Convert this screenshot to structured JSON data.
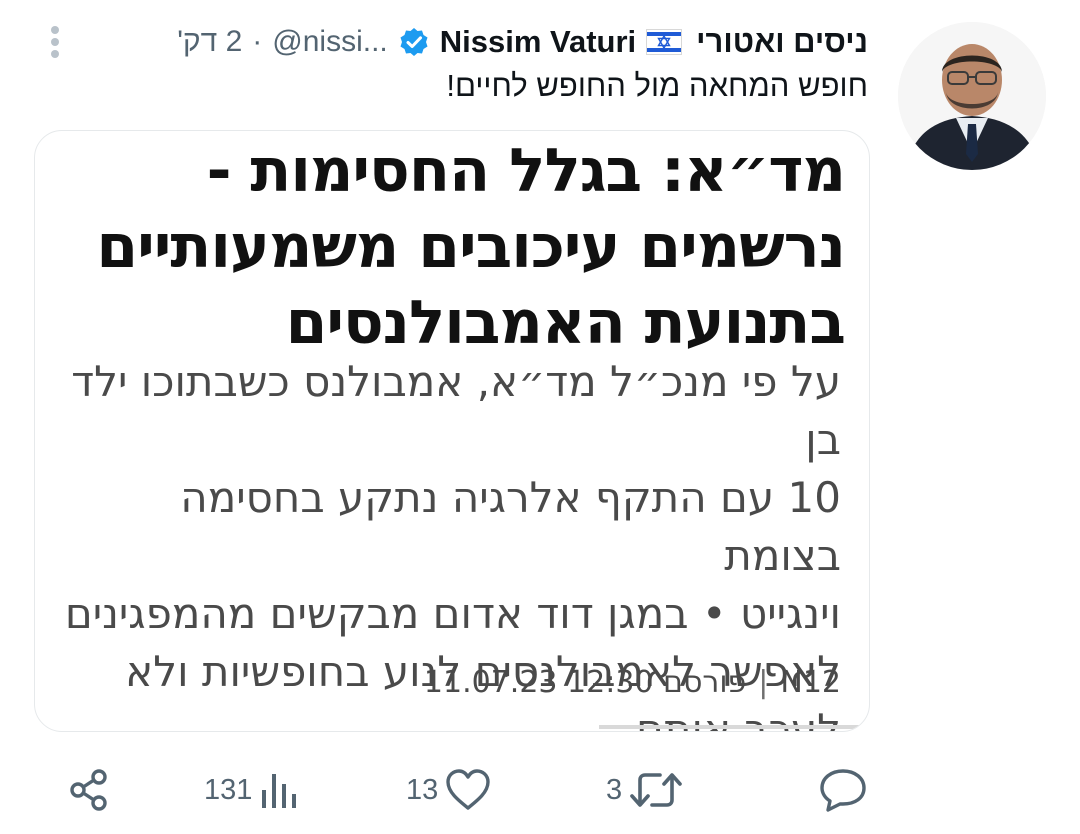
{
  "author": {
    "display_name": "ניסים ואטורי",
    "name_latin": "Nissim Vaturi",
    "flag_icon": "israel-flag-icon",
    "verified_icon": "verified-badge-icon",
    "handle": "@nissi...",
    "separator": "·",
    "time_ago": "2 דק'"
  },
  "tweet": {
    "text": "חופש המחאה מול החופש לחיים!"
  },
  "card": {
    "headline_lines": [
      "מד״א: בגלל החסימות -",
      "נרשמים עיכובים משמעותיים",
      "בתנועת האמבולנסים"
    ],
    "body_lines": [
      "על פי מנכ״ל מד״א, אמבולנס כשבתוכו ילד בן",
      "10 עם התקף אלרגיה נתקע בחסימה בצומת",
      "וינגייט • במגן דוד אדום מבקשים מהמפגינים",
      "לאפשר לאמבולנסים לנוע בחופשיות ולא",
      "לעכב אותם"
    ],
    "footer_source": "N12",
    "footer_separator": "|",
    "footer_published": "פורסם",
    "footer_datetime": "11.07.23 12:30"
  },
  "actions": {
    "reply_icon": "reply-icon",
    "retweet_count": "3",
    "retweet_icon": "retweet-icon",
    "like_count": "13",
    "like_icon": "heart-icon",
    "views_count": "131",
    "views_icon": "views-chart-icon",
    "share_icon": "share-icon"
  },
  "colors": {
    "verified": "#1d9bf0",
    "secondary_text": "#536471",
    "flag_blue": "#1f5bd6"
  }
}
